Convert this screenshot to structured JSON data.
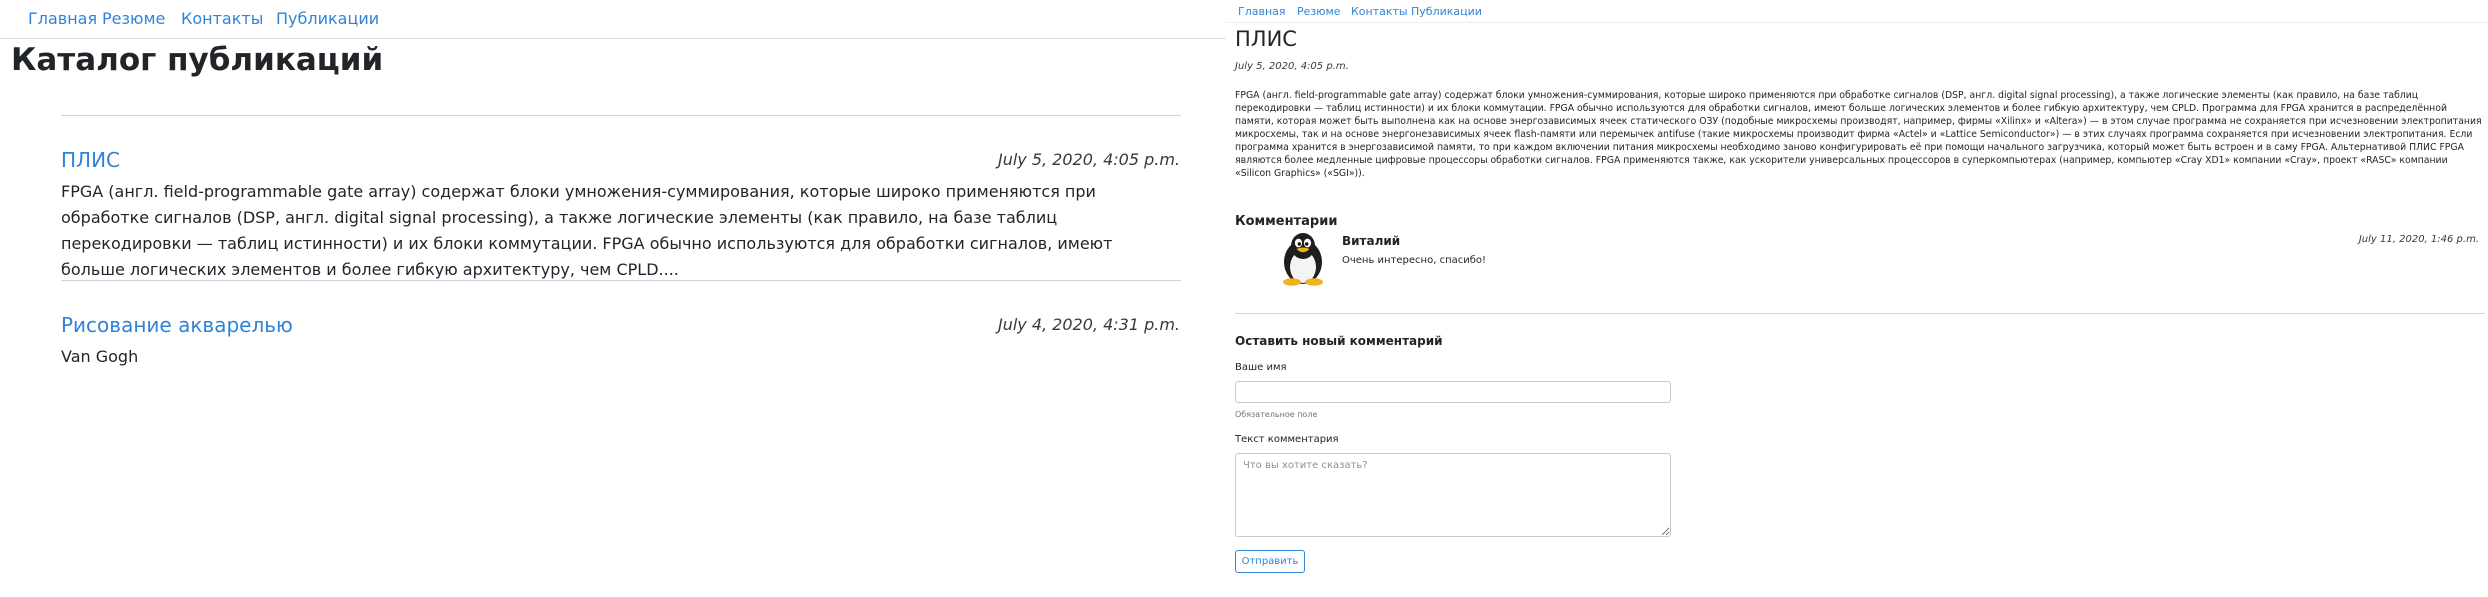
{
  "nav": {
    "items": [
      "Главная",
      "Резюме",
      "Контакты",
      "Публикации"
    ]
  },
  "catalog": {
    "title": "Каталог публикаций",
    "posts": [
      {
        "title": "ПЛИС",
        "date": "July 5, 2020, 4:05 p.m.",
        "excerpt": "FPGA (англ. field-programmable gate array) содержат блоки умножения-суммирования, которые широко применяются при обработке сигналов (DSP, англ. digital signal processing), а также логические элементы (как правило, на базе таблиц перекодировки — таблиц истинности) и их блоки коммутации. FPGA обычно используются для обработки сигналов, имеют больше логических элементов и более гибкую архитектуру, чем CPLD...."
      },
      {
        "title": "Рисование акварелью",
        "date": "July 4, 2020, 4:31 p.m.",
        "excerpt": "Van Gogh"
      }
    ]
  },
  "detail": {
    "title": "ПЛИС",
    "date": "July 5, 2020, 4:05 p.m.",
    "body": "FPGA (англ. field-programmable gate array) содержат блоки умножения-суммирования, которые широко применяются при обработке сигналов (DSP, англ. digital signal processing), а также логические элементы (как правило, на базе таблиц перекодировки — таблиц истинности) и их блоки коммутации. FPGA обычно используются для обработки сигналов, имеют больше логических элементов и более гибкую архитектуру, чем CPLD. Программа для FPGA хранится в распределённой памяти, которая может быть выполнена как на основе энергозависимых ячеек статического ОЗУ (подобные микросхемы производят, например, фирмы «Xilinx» и «Altera») — в этом случае программа не сохраняется при исчезновении электропитания микросхемы, так и на основе энергонезависимых ячеек flash-памяти или перемычек antifuse (такие микросхемы производит фирма «Actel» и «Lattice Semiconductor») — в этих случаях программа сохраняется при исчезновении электропитания. Если программа хранится в энергозависимой памяти, то при каждом включении питания микросхемы необходимо заново конфигурировать её при помощи начального загрузчика, который может быть встроен и в саму FPGA. Альтернативой ПЛИС FPGA являются более медленные цифровые процессоры обработки сигналов. FPGA применяются также, как ускорители универсальных процессоров в суперкомпьютерах (например, компьютер «Cray XD1» компании «Cray», проект «RASC» компании «Silicon Graphics» («SGI»)).",
    "comments_heading": "Комментарии",
    "comments": [
      {
        "author": "Виталий",
        "date": "July 11, 2020, 1:46 p.m.",
        "text": "Очень интересно, спасибо!",
        "avatar_icon": "tux-penguin-icon"
      }
    ],
    "form": {
      "title": "Оставить новый комментарий",
      "name_label": "Ваше имя",
      "name_value": "",
      "name_help": "Обязательное поле",
      "text_label": "Текст комментария",
      "text_placeholder": "Что вы хотите сказать?",
      "submit_label": "Отправить"
    }
  },
  "colors": {
    "link": "#2f84d8",
    "text": "#212529",
    "divider": "#cbd5e0"
  }
}
